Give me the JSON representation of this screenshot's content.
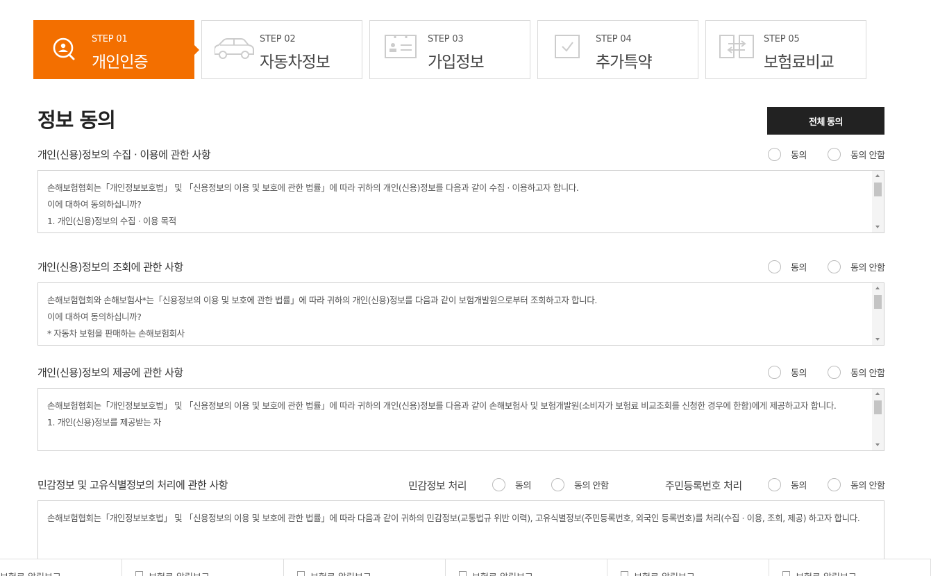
{
  "steps": [
    {
      "num": "STEP 01",
      "label": "개인인증",
      "icon": "search-user-icon",
      "active": true
    },
    {
      "num": "STEP 02",
      "label": "자동차정보",
      "icon": "car-icon",
      "active": false
    },
    {
      "num": "STEP 03",
      "label": "가입정보",
      "icon": "id-card-icon",
      "active": false
    },
    {
      "num": "STEP 04",
      "label": "추가특약",
      "icon": "checkbox-icon",
      "active": false
    },
    {
      "num": "STEP 05",
      "label": "보험료비교",
      "icon": "compare-icon",
      "active": false
    }
  ],
  "colors": {
    "accent": "#f36f00",
    "dark_button": "#222222"
  },
  "title": "정보 동의",
  "agree_all_label": "전체 동의",
  "radio": {
    "agree": "동의",
    "disagree": "동의 안함"
  },
  "sections": [
    {
      "title": "개인(신용)정보의 수집 · 이용에 관한 사항",
      "lines": [
        "손해보험협회는「개인정보보호법」 및 「신용정보의 이용 및 보호에 관한 법률」에 따라 귀하의 개인(신용)정보를 다음과 같이 수집 · 이용하고자 합니다.",
        "이에 대하여 동의하십니까?",
        "1. 개인(신용)정보의 수집 · 이용 목적"
      ]
    },
    {
      "title": "개인(신용)정보의 조회에 관한 사항",
      "lines": [
        "손해보험협회와 손해보험사*는「신용정보의 이용 및 보호에 관한 법률」에 따라 귀하의 개인(신용)정보를 다음과 같이 보험개발원으로부터 조회하고자 합니다.",
        "이에 대하여 동의하십니까?",
        "* 자동차 보험을 판매하는 손해보험회사"
      ]
    },
    {
      "title": "개인(신용)정보의 제공에 관한 사항",
      "lines": [
        "손해보험협회는「개인정보보호법」 및 「신용정보의 이용 및 보호에 관한 법률」에 따라 귀하의 개인(신용)정보를 다음과 같이 손해보험사 및 보험개발원(소비자가 보험료 비교조회를 신청한 경우에 한함)에게 제공하고자 합니다.",
        "1. 개인(신용)정보를 제공받는 자"
      ]
    },
    {
      "title": "민감정보 및 고유식별정보의 처리에 관한 사항",
      "sensitive_label": "민감정보 처리",
      "rrn_label": "주민등록번호 처리",
      "lines": [
        "손해보험협회는「개인정보보호법」 및 「신용정보의 이용 및 보호에 관한 법률」에 따라 다음과 같이 귀하의 민감정보(교통법규 위반 이력), 고유식별정보(주민등록번호, 외국인 등록번호)를 처리(수집 · 이용, 조회, 제공) 하고자 합니다."
      ]
    }
  ],
  "bottom_items": [
    "보험료 알림보고",
    "보험료 알림보고",
    "보험료 알림보고",
    "보험료 알림보고",
    "보험료 알림보고",
    "보험료 알림보고"
  ]
}
